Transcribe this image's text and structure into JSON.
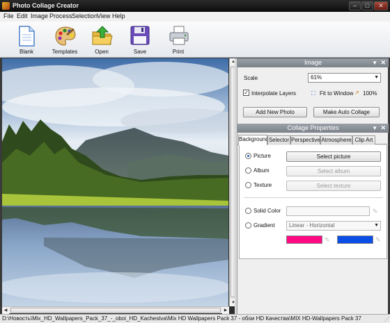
{
  "app": {
    "title": "Photo Collage Creator"
  },
  "window_controls": {
    "minimize": "–",
    "maximize": "□",
    "close": "✕"
  },
  "menu": [
    "File",
    "Edit",
    "Image",
    "Process",
    "Selection",
    "View",
    "Help"
  ],
  "toolbar": {
    "blank": {
      "label": "Blank",
      "icon": "blank-page-icon"
    },
    "templates": {
      "label": "Templates",
      "icon": "palette-icon"
    },
    "open": {
      "label": "Open",
      "icon": "open-folder-icon"
    },
    "save": {
      "label": "Save",
      "icon": "floppy-disk-icon"
    },
    "print": {
      "label": "Print",
      "icon": "printer-icon"
    }
  },
  "image_panel": {
    "title": "Image",
    "scale_label": "Scale",
    "scale_value": "61%",
    "interpolate_label": "Interpolate Layers",
    "interpolate_checked": true,
    "fit_to_window": "Fit to Window",
    "zoom_100": "100%",
    "add_photo_button": "Add New Photo",
    "auto_collage_button": "Make Auto Collage"
  },
  "collage_panel": {
    "title": "Collage Properties",
    "tabs": [
      "Background",
      "Selector",
      "Perspective",
      "Atmosphere",
      "Clip Art"
    ],
    "active_tab": "Background",
    "options": {
      "picture": "Picture",
      "album": "Album",
      "texture": "Texture",
      "solid_color": "Solid Color",
      "gradient": "Gradient"
    },
    "selected_option": "Picture",
    "select_picture_button": "Select picture",
    "select_album_button": "Select album",
    "select_texture_button": "Select texture",
    "gradient_value": "Linear - Horizontal",
    "gradient_color_1": "#ff0a84",
    "gradient_color_2": "#0a4ee6"
  },
  "status": {
    "path": "D:\\Новость\\Mix_HD_Wallpapers_Pack_37_-_oboi_HD_Kachestva\\Mix HD Wallpapers Pack 37 - обои HD Качества\\MIX HD-Wallpapers Pack 37"
  },
  "colors": {
    "panel_header": "#8a9098",
    "toolbar_bg": "#eef0f3",
    "accent_blue": "#2a5ab8"
  }
}
